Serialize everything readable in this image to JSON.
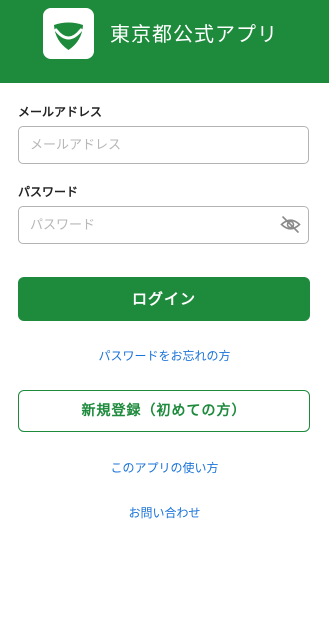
{
  "header": {
    "logo_icon": "ginkgo-leaf-icon",
    "title": "東京都公式アプリ",
    "background": "#1d8a3c"
  },
  "email": {
    "label": "メールアドレス",
    "placeholder": "メールアドレス",
    "value": ""
  },
  "password": {
    "label": "パスワード",
    "placeholder": "パスワード",
    "value": "",
    "toggle_icon": "eye-slash-icon"
  },
  "buttons": {
    "login_label": "ログイン",
    "register_label": "新規登録（初めての方）"
  },
  "links": {
    "forgot_password": "パスワードをお忘れの方",
    "how_to_use": "このアプリの使い方",
    "contact": "お問い合わせ"
  },
  "colors": {
    "primary": "#1d8a3c",
    "link": "#1a73d9"
  }
}
